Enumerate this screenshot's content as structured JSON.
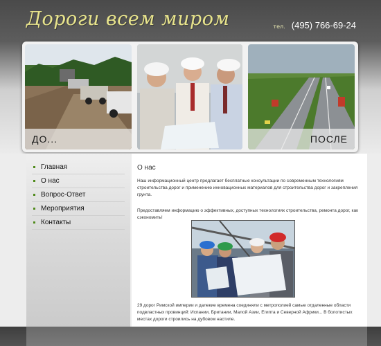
{
  "header": {
    "logo_text": "Дороги всем миром",
    "phone_label": "тел.",
    "phone_number": "(495) 766-69-24"
  },
  "banner": {
    "before_label": "ДО...",
    "after_label": "ПОСЛЕ"
  },
  "menu": {
    "items": [
      {
        "label": "Главная"
      },
      {
        "label": "О нас"
      },
      {
        "label": "Вопрос-Ответ"
      },
      {
        "label": "Мероприятия"
      },
      {
        "label": "Контакты"
      }
    ]
  },
  "content": {
    "title": "О нас",
    "paragraph1": "Наш информационный центр предлагает бесплатные консультации по современным технологиям строительства дорог и применению инновационных материалов для строительства дорог и закрепления грунта.",
    "paragraph2": "Предоставляем информацию о эффективных, доступных технологиях строительства, ремонта дорог, как сэкономить!",
    "paragraph3": "29 дорог Римской империи и далекие времена соединяли с метрополией самые отдаленные области подвластных провинций: Испании, Британии, Малой Азии, Египта и Северной Африки... В болотистых местах дороги строились на дубовом настиле."
  },
  "colors": {
    "logo": "#e8e48c",
    "bullet": "#4f8a1a",
    "header_dark": "#4a4a4a"
  }
}
